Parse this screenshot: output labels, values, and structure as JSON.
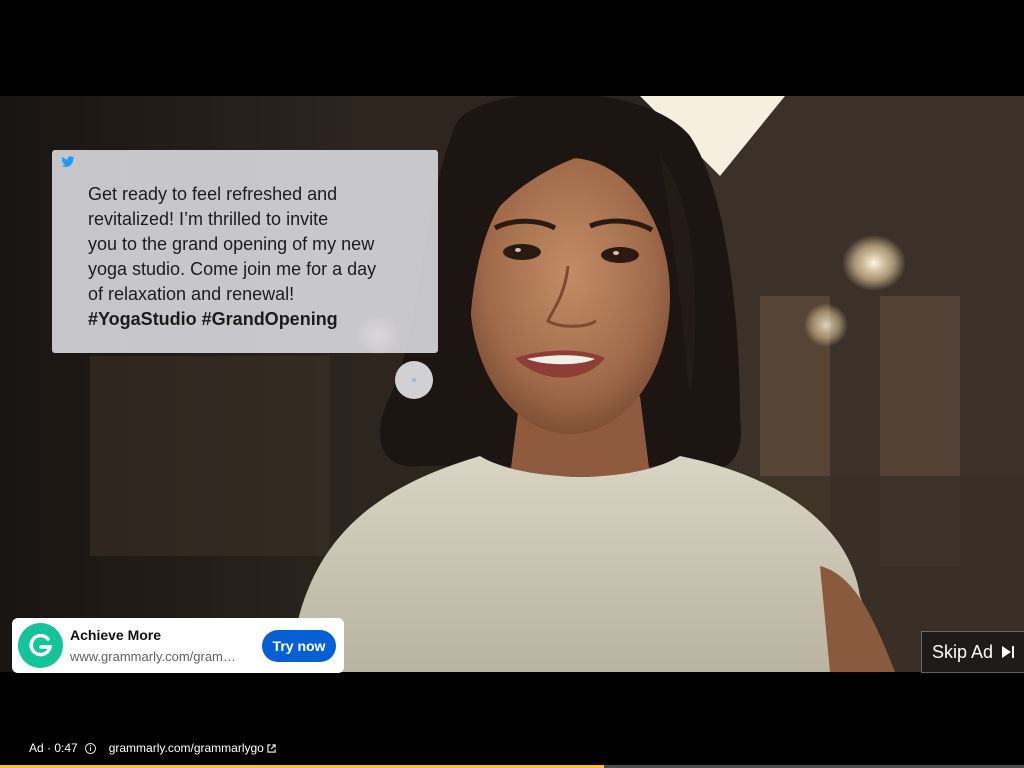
{
  "tweet_overlay": {
    "lines": [
      "Get ready to feel refreshed and",
      "revitalized! I’m thrilled to invite",
      "you to the grand opening of my new",
      "yoga studio. Come join me for a day",
      "of relaxation and renewal!"
    ],
    "hashtags": "#YogaStudio #GrandOpening",
    "icon": "twitter-bird-icon"
  },
  "sponsor_card": {
    "title": "Achieve More",
    "url": "www.grammarly.com/grammarlygo",
    "cta_label": "Try now",
    "logo_icon": "grammarly-g-icon",
    "logo_color": "#15c39a",
    "cta_color": "#065fd4"
  },
  "skip_ad": {
    "label": "Skip Ad",
    "icon": "skip-next-icon"
  },
  "ad_info": {
    "label": "Ad · 0:47",
    "link_text": "grammarly.com/grammarlygo",
    "info_icon": "info-icon",
    "link_icon": "external-link-icon"
  },
  "progress": {
    "played_fraction": 0.59,
    "fill_color": "#fbc02d"
  }
}
